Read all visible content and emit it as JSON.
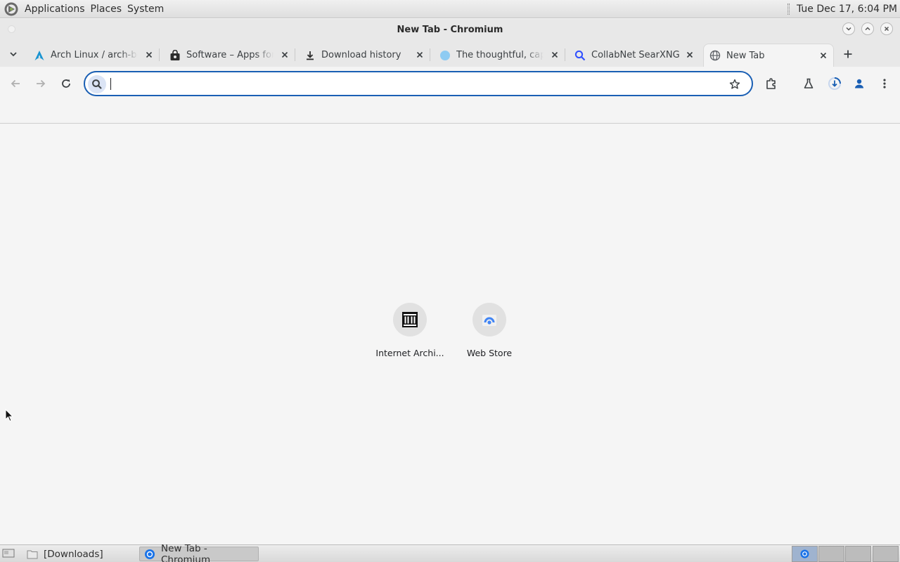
{
  "top_panel": {
    "menus": [
      "Applications",
      "Places",
      "System"
    ],
    "clock": "Tue Dec 17,  6:04 PM"
  },
  "window": {
    "title": "New Tab - Chromium"
  },
  "tabs": [
    {
      "label": "Arch Linux / arch-boxes",
      "favicon": "arch-logo-icon",
      "active": false
    },
    {
      "label": "Software – Apps for GNOME",
      "favicon": "shopping-bag-icon",
      "active": false
    },
    {
      "label": "Download history",
      "favicon": "download-icon",
      "active": false
    },
    {
      "label": "The thoughtful, capable AI",
      "favicon": "globe-blue-icon",
      "active": false
    },
    {
      "label": "CollabNet SearXNG",
      "favicon": "search-icon",
      "active": false
    },
    {
      "label": "New Tab",
      "favicon": "globe-icon",
      "active": true
    }
  ],
  "omnibox": {
    "value": "",
    "placeholder": ""
  },
  "shortcuts": [
    {
      "label": "Internet Archi...",
      "icon": "internet-archive-icon"
    },
    {
      "label": "Web Store",
      "icon": "web-store-icon"
    }
  ],
  "taskbar": {
    "items": [
      {
        "label": "[Downloads]",
        "icon": "folder-icon",
        "active": false
      },
      {
        "label": "New Tab - Chromium",
        "icon": "chromium-icon",
        "active": true
      }
    ]
  },
  "colors": {
    "accent": "#1a5fb4",
    "tabstrip_bg": "#e8e8e8",
    "content_bg": "#f5f5f5"
  }
}
